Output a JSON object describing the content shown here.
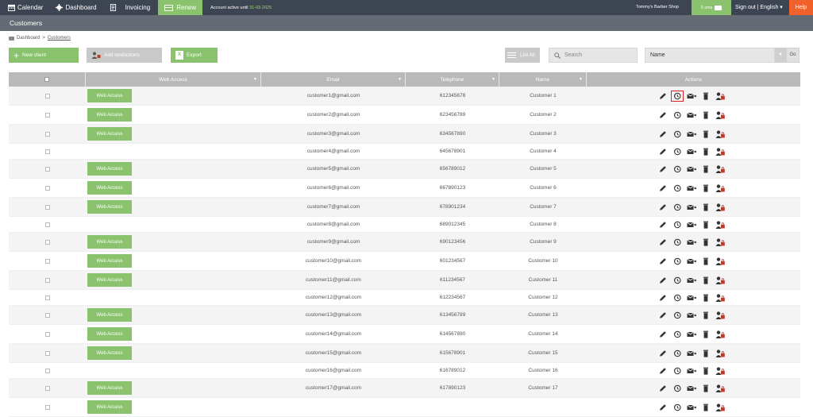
{
  "topbar": {
    "calendar": "Calendar",
    "dashboard": "Dashboard",
    "invoicing": "Invoicing",
    "renew": "Renew",
    "account_prefix": "Account active until",
    "account_date": "31-03-2025",
    "shop": "Tommy's Barber Shop",
    "sms": "5 sms",
    "signout": "Sign out | English ▾",
    "help": "Help"
  },
  "page": {
    "title": "Customers",
    "breadcrumb_home": "Dashboard",
    "breadcrumb_sep": ">",
    "breadcrumb_current": "Customers"
  },
  "toolbar": {
    "new_client": "New client",
    "add_restrictions": "Add restrictions",
    "export": "Export",
    "list_all": "List All",
    "search_placeholder": "Search",
    "select_value": "Name",
    "go": "Go"
  },
  "table": {
    "headers": [
      "Web Access",
      "Email",
      "Telephone",
      "Name",
      "Actions"
    ],
    "web_access_label": "Web Access",
    "rows": [
      {
        "web": true,
        "email": "customer1@gmail.com",
        "phone": "612345678",
        "name": "Customer 1"
      },
      {
        "web": true,
        "email": "customer2@gmail.com",
        "phone": "623456789",
        "name": "Customer 2"
      },
      {
        "web": true,
        "email": "customer3@gmail.com",
        "phone": "634567890",
        "name": "Customer 3"
      },
      {
        "web": false,
        "email": "customer4@gmail.com",
        "phone": "645678901",
        "name": "Customer 4"
      },
      {
        "web": true,
        "email": "customer5@gmail.com",
        "phone": "656789012",
        "name": "Customer 5"
      },
      {
        "web": true,
        "email": "customer6@gmail.com",
        "phone": "667890123",
        "name": "Customer 6"
      },
      {
        "web": true,
        "email": "customer7@gmail.com",
        "phone": "678901234",
        "name": "Customer 7"
      },
      {
        "web": false,
        "email": "customer8@gmail.com",
        "phone": "689012345",
        "name": "Customer 8"
      },
      {
        "web": true,
        "email": "customer9@gmail.com",
        "phone": "690123456",
        "name": "Customer 9"
      },
      {
        "web": true,
        "email": "customer10@gmail.com",
        "phone": "601234567",
        "name": "Customer 10"
      },
      {
        "web": true,
        "email": "customer11@gmail.com",
        "phone": "611234567",
        "name": "Customer 11"
      },
      {
        "web": false,
        "email": "customer12@gmail.com",
        "phone": "612234567",
        "name": "Customer 12"
      },
      {
        "web": true,
        "email": "customer13@gmail.com",
        "phone": "613456789",
        "name": "Customer 13"
      },
      {
        "web": true,
        "email": "customer14@gmail.com",
        "phone": "614567890",
        "name": "Customer 14"
      },
      {
        "web": true,
        "email": "customer15@gmail.com",
        "phone": "615678901",
        "name": "Customer 15"
      },
      {
        "web": false,
        "email": "customer16@gmail.com",
        "phone": "616789012",
        "name": "Customer 16"
      },
      {
        "web": true,
        "email": "customer17@gmail.com",
        "phone": "617890123",
        "name": "Customer 17"
      },
      {
        "web": true,
        "email": "",
        "phone": "",
        "name": ""
      }
    ]
  },
  "colors": {
    "topbar": "#3d4452",
    "titlebar": "#656b74",
    "accent_green": "#8ac26d",
    "help_orange": "#f0612c",
    "highlight_red": "#e02020"
  }
}
